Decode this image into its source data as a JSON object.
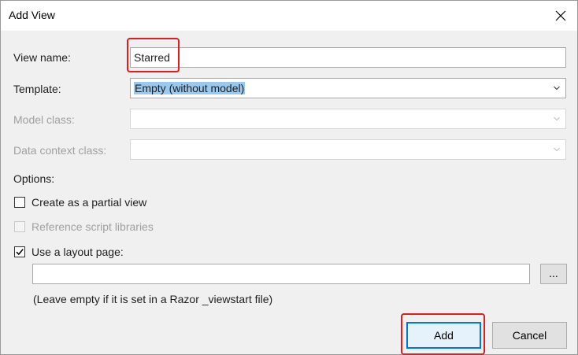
{
  "dialog": {
    "title": "Add View"
  },
  "form": {
    "view_name_label": "View name:",
    "view_name_value": "Starred",
    "template_label": "Template:",
    "template_value": "Empty (without model)",
    "model_class_label": "Model class:",
    "model_class_value": "",
    "data_context_label": "Data context class:",
    "data_context_value": "",
    "options_label": "Options:",
    "partial_view_label": "Create as a partial view",
    "partial_view_checked": false,
    "script_libraries_label": "Reference script libraries",
    "script_libraries_checked": false,
    "layout_page_label": "Use a layout page:",
    "layout_page_checked": true,
    "layout_page_value": "",
    "browse_label": "...",
    "layout_hint": "(Leave empty if it is set in a Razor _viewstart file)"
  },
  "buttons": {
    "add_label": "Add",
    "cancel_label": "Cancel"
  },
  "icons": {
    "close": "close-icon",
    "dropdown": "chevron-down-icon",
    "check": "checkmark-icon"
  },
  "colors": {
    "accent": "#0078d7",
    "highlight": "#e41b1b",
    "selection": "#99c9ef"
  }
}
